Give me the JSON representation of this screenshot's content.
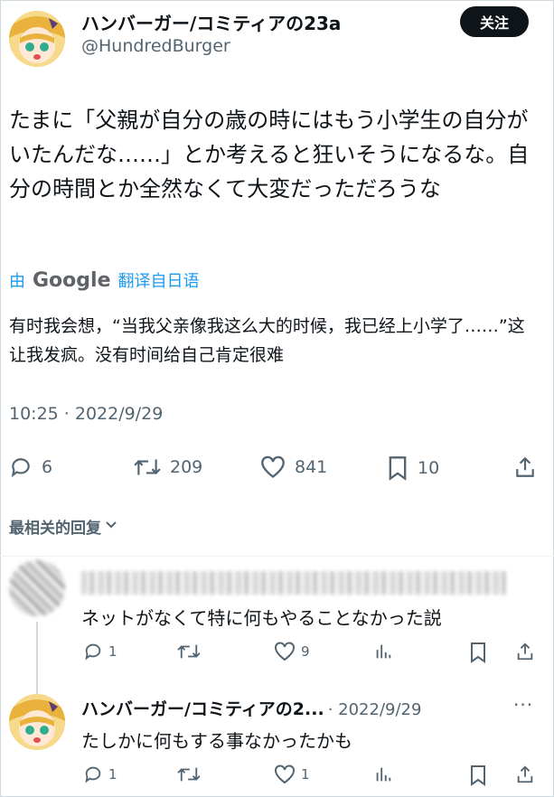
{
  "main_tweet": {
    "display_name": "ハンバーガー/コミティアの23a",
    "handle": "@HundredBurger",
    "follow_label": "关注",
    "text": "たまに「父親が自分の歳の時にはもう小学生の自分がいたんだな……」とか考えると狂いそうになるな。自分の時間とか全然なくて大変だっただろうな",
    "translated_by_prefix": "由",
    "translated_by_brand": "Google",
    "translated_from": "翻译自日语",
    "translation": "有时我会想，“当我父亲像我这么大的时候，我已经上小学了……”这让我发疯。没有时间给自己肯定很难",
    "timestamp": "10:25 · 2022/9/29",
    "stats": {
      "replies": "6",
      "retweets": "209",
      "likes": "841",
      "bookmarks": "10"
    },
    "icons": [
      "reply-icon",
      "retweet-icon",
      "like-icon",
      "bookmark-icon",
      "share-icon"
    ]
  },
  "replies_sort_label": "最相关的回复",
  "replies": [
    {
      "text": "ネットがなくて特に何もやることなかった説",
      "stats": {
        "replies": "1",
        "retweets": "",
        "likes": "9"
      }
    },
    {
      "display_name": "ハンバーガー/コミティアの2...",
      "meta": "· 2022/9/29",
      "text": "たしかに何もする事なかったかも",
      "stats": {
        "replies": "1",
        "retweets": "",
        "likes": "1"
      }
    }
  ],
  "colors": {
    "text": "#0f1419",
    "secondary": "#536471",
    "link": "#1d9bf0",
    "border": "#eff3f4"
  }
}
